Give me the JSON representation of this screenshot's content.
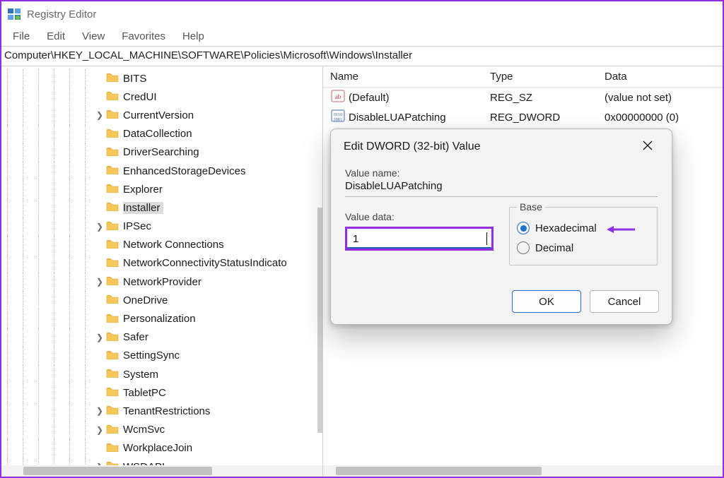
{
  "window": {
    "title": "Registry Editor"
  },
  "menubar": [
    "File",
    "Edit",
    "View",
    "Favorites",
    "Help"
  ],
  "addressbar": "Computer\\HKEY_LOCAL_MACHINE\\SOFTWARE\\Policies\\Microsoft\\Windows\\Installer",
  "tree": {
    "indent_levels": 7,
    "items": [
      {
        "label": "BITS",
        "expandable": false,
        "depth": 7
      },
      {
        "label": "CredUI",
        "expandable": false,
        "depth": 7
      },
      {
        "label": "CurrentVersion",
        "expandable": true,
        "depth": 7
      },
      {
        "label": "DataCollection",
        "expandable": false,
        "depth": 7
      },
      {
        "label": "DriverSearching",
        "expandable": false,
        "depth": 7
      },
      {
        "label": "EnhancedStorageDevices",
        "expandable": false,
        "depth": 7
      },
      {
        "label": "Explorer",
        "expandable": false,
        "depth": 7
      },
      {
        "label": "Installer",
        "expandable": false,
        "depth": 7,
        "selected": true
      },
      {
        "label": "IPSec",
        "expandable": true,
        "depth": 7
      },
      {
        "label": "Network Connections",
        "expandable": false,
        "depth": 7
      },
      {
        "label": "NetworkConnectivityStatusIndicato",
        "expandable": false,
        "depth": 7
      },
      {
        "label": "NetworkProvider",
        "expandable": true,
        "depth": 7
      },
      {
        "label": "OneDrive",
        "expandable": false,
        "depth": 7
      },
      {
        "label": "Personalization",
        "expandable": false,
        "depth": 7
      },
      {
        "label": "Safer",
        "expandable": true,
        "depth": 7
      },
      {
        "label": "SettingSync",
        "expandable": false,
        "depth": 7
      },
      {
        "label": "System",
        "expandable": false,
        "depth": 7
      },
      {
        "label": "TabletPC",
        "expandable": false,
        "depth": 7
      },
      {
        "label": "TenantRestrictions",
        "expandable": true,
        "depth": 7
      },
      {
        "label": "WcmSvc",
        "expandable": true,
        "depth": 7
      },
      {
        "label": "WorkplaceJoin",
        "expandable": false,
        "depth": 7
      },
      {
        "label": "WSDAPI",
        "expandable": true,
        "depth": 7
      }
    ]
  },
  "list": {
    "headers": {
      "name": "Name",
      "type": "Type",
      "data": "Data"
    },
    "rows": [
      {
        "icon": "sz",
        "name": "(Default)",
        "type": "REG_SZ",
        "data": "(value not set)"
      },
      {
        "icon": "dword",
        "name": "DisableLUAPatching",
        "type": "REG_DWORD",
        "data": "0x00000000 (0)"
      }
    ]
  },
  "dialog": {
    "title": "Edit DWORD (32-bit) Value",
    "value_name_label": "Value name:",
    "value_name": "DisableLUAPatching",
    "value_data_label": "Value data:",
    "value_data": "1",
    "base_label": "Base",
    "radio_hex": "Hexadecimal",
    "radio_dec": "Decimal",
    "selected_base": "Hexadecimal",
    "ok": "OK",
    "cancel": "Cancel"
  },
  "colors": {
    "accent": "#922fe6",
    "win_blue": "#1f6fcf"
  }
}
